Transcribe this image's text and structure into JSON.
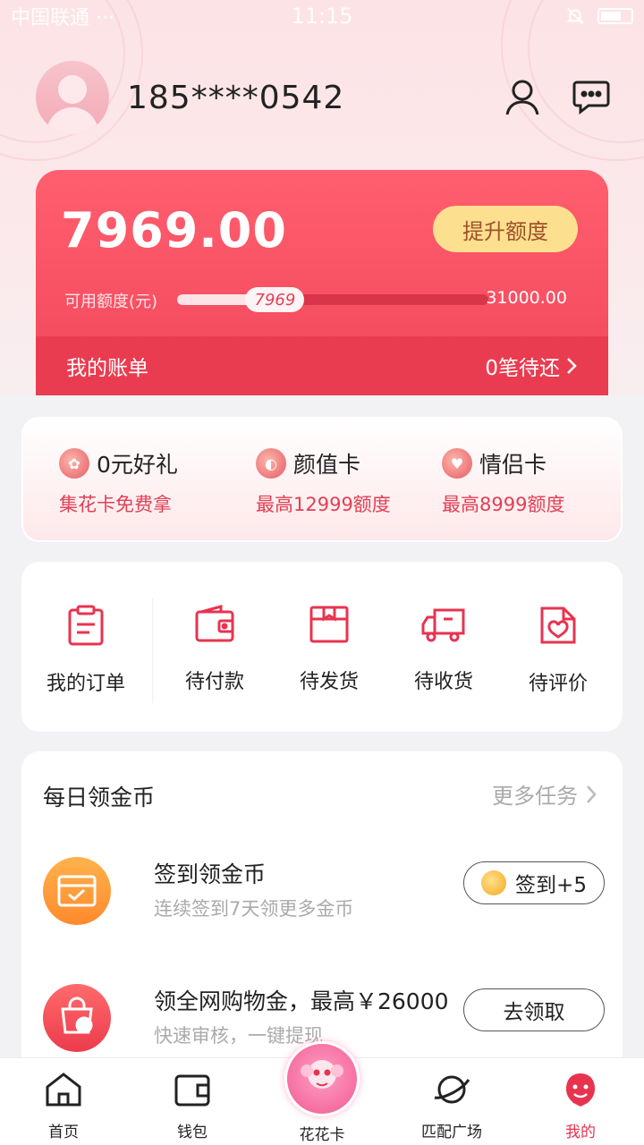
{
  "status_bar": {
    "carrier": "中国联通 ···",
    "time": "11:15"
  },
  "profile": {
    "phone": "185****0542"
  },
  "credit": {
    "amount": "7969.00",
    "raise_button": "提升额度",
    "available_label": "可用额度(元)",
    "available_value": "7969",
    "total_limit": "31000.00",
    "available_fraction": 0.257,
    "bill_label": "我的账单",
    "bill_status": "0笔待还",
    "accent_color": "#f2475b"
  },
  "promos": [
    {
      "title": "0元好礼",
      "subtitle": "集花卡免费拿",
      "icon": "flower-icon"
    },
    {
      "title": "颜值卡",
      "subtitle": "最高12999额度",
      "icon": "face-icon"
    },
    {
      "title": "情侣卡",
      "subtitle": "最高8999额度",
      "icon": "heart-icon"
    }
  ],
  "orders": [
    {
      "label": "我的订单",
      "icon": "clipboard-icon"
    },
    {
      "label": "待付款",
      "icon": "wallet-icon"
    },
    {
      "label": "待发货",
      "icon": "box-icon"
    },
    {
      "label": "待收货",
      "icon": "truck-icon"
    },
    {
      "label": "待评价",
      "icon": "review-heart-icon"
    }
  ],
  "daily_tasks": {
    "title": "每日领金币",
    "more": "更多任务",
    "items": [
      {
        "title": "签到领金币",
        "subtitle": "连续签到7天领更多金币",
        "button": "签到+5",
        "icon": "calendar-check-icon"
      },
      {
        "title": "领全网购物金，最高￥26000",
        "subtitle": "快速审核，一键提现",
        "button": "去领取",
        "icon": "shopping-bag-icon"
      }
    ]
  },
  "tabbar": {
    "items": [
      {
        "label": "首页",
        "icon": "home-icon"
      },
      {
        "label": "钱包",
        "icon": "wallet-icon"
      },
      {
        "label": "花花卡",
        "icon": "huahua-card-icon"
      },
      {
        "label": "匹配广场",
        "icon": "planet-icon"
      },
      {
        "label": "我的",
        "icon": "me-icon"
      }
    ],
    "active_index": 4,
    "active_color": "#e8334f"
  }
}
